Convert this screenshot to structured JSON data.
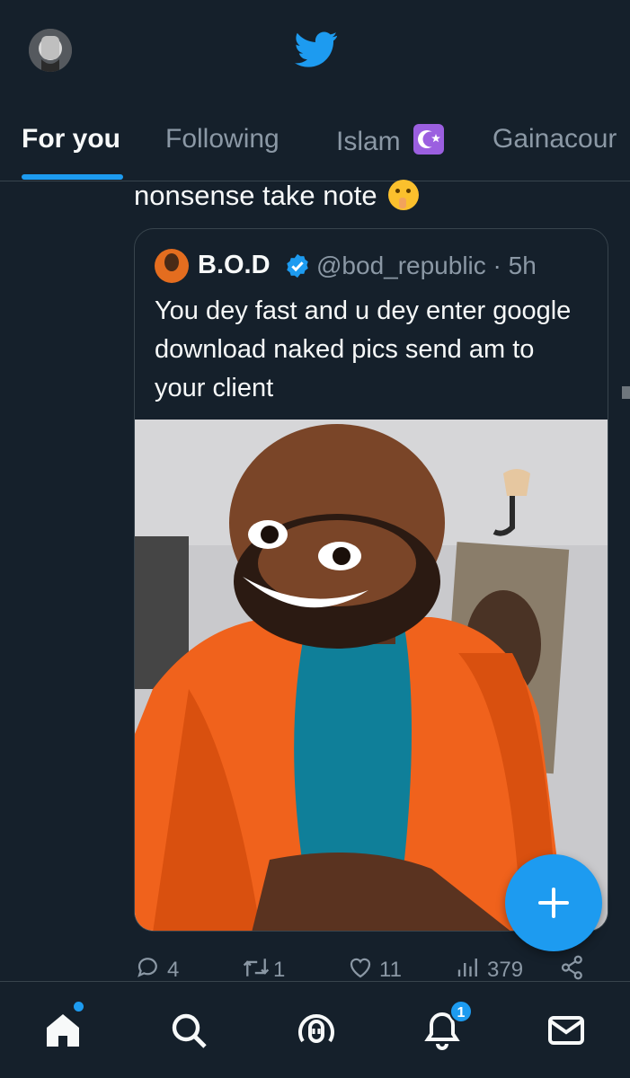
{
  "header": {
    "avatar": "profile-avatar",
    "logo": "twitter-bird-icon"
  },
  "tabs": [
    {
      "label": "For you",
      "active": true
    },
    {
      "label": "Following",
      "active": false
    },
    {
      "label": "Islam",
      "active": false,
      "emoji": "star-and-crescent-icon"
    },
    {
      "label": "Gainacour",
      "active": false
    }
  ],
  "tweet": {
    "text": "nonsense take note",
    "emoji": "shushing-face-emoji",
    "quote": {
      "name": "B.O.D",
      "handle": "@bod_republic · 5h",
      "text": "You dey fast and u dey enter google download naked pics send am to your client",
      "media": "photo-smiling-man-orange-blazer"
    },
    "actions": {
      "replies": "4",
      "retweets": "1",
      "likes": "11",
      "views": "379"
    }
  },
  "nav": {
    "items": [
      "home-icon",
      "search-icon",
      "spaces-icon",
      "notifications-icon",
      "messages-icon"
    ],
    "notification_count": "1"
  },
  "colors": {
    "background": "#15202b",
    "accent": "#1d9bf0",
    "muted": "#8b98a5",
    "border": "#38444d"
  }
}
